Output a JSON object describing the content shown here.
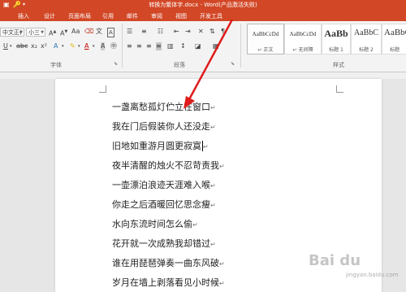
{
  "window": {
    "title": "转换为繁体字.docx - Word(产品激活失败)",
    "accent_color": "#d24726"
  },
  "tabs": [
    {
      "label": "插入"
    },
    {
      "label": "设计"
    },
    {
      "label": "页面布局"
    },
    {
      "label": "引用"
    },
    {
      "label": "邮件"
    },
    {
      "label": "审阅"
    },
    {
      "label": "视图"
    },
    {
      "label": "开发工具"
    }
  ],
  "font": {
    "family_value": "中文正(",
    "size_value": "小三",
    "group_label": "字体"
  },
  "paragraph": {
    "group_label": "段落"
  },
  "styles": {
    "group_label": "样式",
    "items": [
      {
        "sample": "AaBbCcDd",
        "name": "↵ 正文"
      },
      {
        "sample": "AaBbCcDd",
        "name": "↵ 无间隔"
      },
      {
        "sample": "AaBb",
        "name": "标题 1"
      },
      {
        "sample": "AaBbC",
        "name": "标题 2"
      },
      {
        "sample": "AaBbC",
        "name": "标题"
      }
    ]
  },
  "document": {
    "lines": [
      "一盏离愁孤灯伫立在窗口",
      "我在门后假装你人还没走",
      "旧地如重游月圆更寂寞",
      "夜半清醒的烛火不忍苛责我",
      "一壶漂泊浪迹天涯难入喉",
      "你走之后酒暖回忆思念瘦",
      "水向东流时间怎么偷",
      "花开就一次成熟我却错过",
      "谁在用琵琶弹奏一曲东风破",
      "岁月在墙上剥落看见小时候"
    ],
    "paragraph_mark": "↵"
  },
  "watermark": {
    "text": "Bai du",
    "sub": "jingyan.baidu.com"
  }
}
